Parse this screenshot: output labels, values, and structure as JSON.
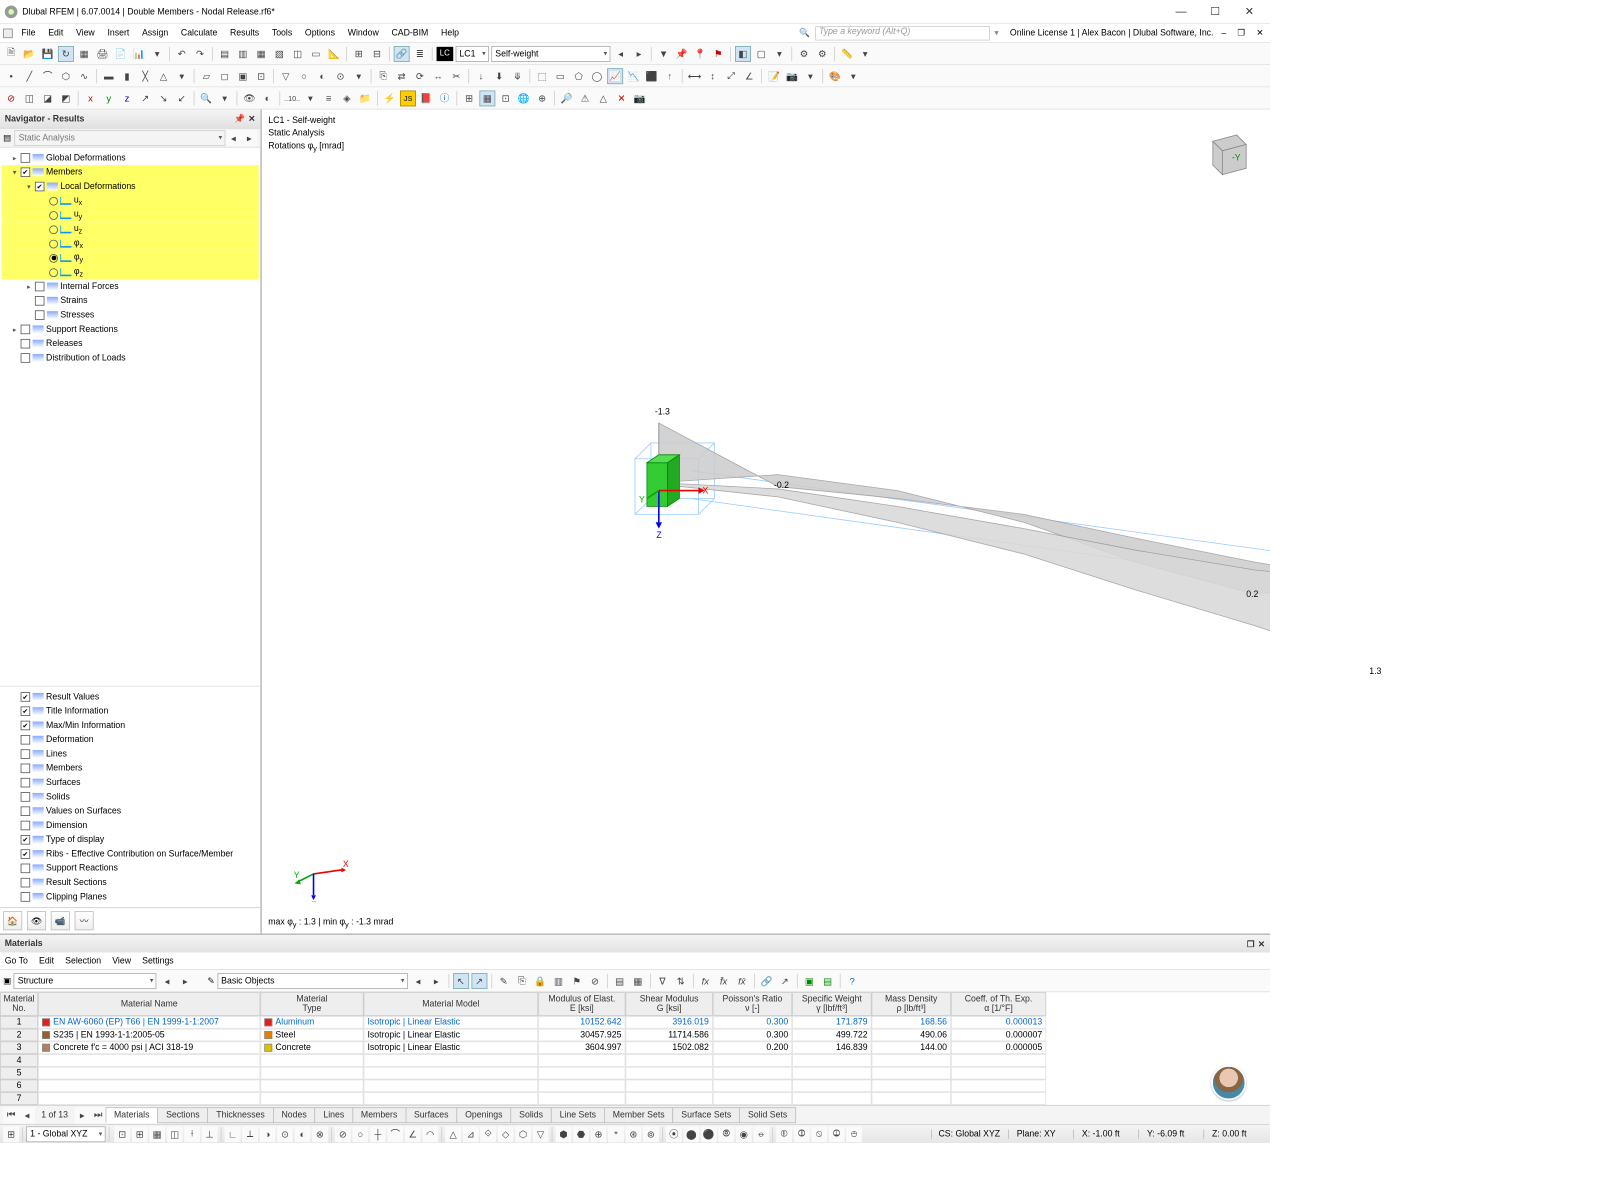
{
  "window": {
    "title": "Dlubal RFEM | 6.07.0014 | Double Members - Nodal Release.rf6*"
  },
  "menu": [
    "File",
    "Edit",
    "View",
    "Insert",
    "Assign",
    "Calculate",
    "Results",
    "Tools",
    "Options",
    "Window",
    "CAD-BIM",
    "Help"
  ],
  "kw_placeholder": "Type a keyword (Alt+Q)",
  "online_status": "Online License 1 | Alex Bacon | Dlubal Software, Inc.",
  "lc_chip": "LC",
  "lc_num": "LC1",
  "lc_name": "Self-weight",
  "navigator": {
    "title": "Navigator - Results",
    "combo": "Static Analysis"
  },
  "tree_top": [
    {
      "lbl": "Global Deformations",
      "ck": false,
      "ind": 0,
      "ar": "▸"
    },
    {
      "lbl": "Members",
      "ck": true,
      "ind": 0,
      "ar": "▾",
      "hl": true
    },
    {
      "lbl": "Local Deformations",
      "ck": true,
      "ind": 1,
      "ar": "▾",
      "hl": true
    },
    {
      "lbl": "u_x",
      "rd": false,
      "ind": 2,
      "hl": true,
      "sub": "x"
    },
    {
      "lbl": "u_y",
      "rd": false,
      "ind": 2,
      "hl": true,
      "sub": "y"
    },
    {
      "lbl": "u_z",
      "rd": false,
      "ind": 2,
      "hl": true,
      "sub": "z"
    },
    {
      "lbl": "φ_x",
      "rd": false,
      "ind": 2,
      "hl": true,
      "sub": "x",
      "ph": true
    },
    {
      "lbl": "φ_y",
      "rd": true,
      "ind": 2,
      "hl": true,
      "sub": "y",
      "ph": true
    },
    {
      "lbl": "φ_z",
      "rd": false,
      "ind": 2,
      "hl": true,
      "sub": "z",
      "ph": true
    },
    {
      "lbl": "Internal Forces",
      "ck": false,
      "ind": 1,
      "ar": "▸"
    },
    {
      "lbl": "Strains",
      "ck": false,
      "ind": 1
    },
    {
      "lbl": "Stresses",
      "ck": false,
      "ind": 1
    },
    {
      "lbl": "Support Reactions",
      "ck": false,
      "ind": 0,
      "ar": "▸"
    },
    {
      "lbl": "Releases",
      "ck": false,
      "ind": 0
    },
    {
      "lbl": "Distribution of Loads",
      "ck": false,
      "ind": 0
    }
  ],
  "tree_bot": [
    {
      "lbl": "Result Values",
      "ck": true
    },
    {
      "lbl": "Title Information",
      "ck": true
    },
    {
      "lbl": "Max/Min Information",
      "ck": true
    },
    {
      "lbl": "Deformation",
      "ck": false
    },
    {
      "lbl": "Lines",
      "ck": false
    },
    {
      "lbl": "Members",
      "ck": false
    },
    {
      "lbl": "Surfaces",
      "ck": false
    },
    {
      "lbl": "Solids",
      "ck": false
    },
    {
      "lbl": "Values on Surfaces",
      "ck": false
    },
    {
      "lbl": "Dimension",
      "ck": false
    },
    {
      "lbl": "Type of display",
      "ck": true
    },
    {
      "lbl": "Ribs - Effective Contribution on Surface/Member",
      "ck": true
    },
    {
      "lbl": "Support Reactions",
      "ck": false
    },
    {
      "lbl": "Result Sections",
      "ck": false
    },
    {
      "lbl": "Clipping Planes",
      "ck": false
    }
  ],
  "vp": {
    "l1": "LC1 - Self-weight",
    "l2": "Static Analysis",
    "l3a": "Rotations φ",
    "l3b": " [mrad]",
    "l3sub": "y",
    "minmax": "max φ_y : 1.3 | min φ_y : -1.3 mrad",
    "a1": "-1.3",
    "a2": "-0.2",
    "a3": "0.2",
    "a4": "1.3"
  },
  "materials": {
    "title": "Materials",
    "menu": [
      "Go To",
      "Edit",
      "Selection",
      "View",
      "Settings"
    ],
    "combo1": "Structure",
    "combo2": "Basic Objects",
    "head1": [
      "Material\nNo.",
      "Material Name",
      "Material\nType",
      "Material Model",
      "Modulus of Elast.\nE [ksi]",
      "Shear Modulus\nG [ksi]",
      "Poisson's Ratio\nν [-]",
      "Specific Weight\nγ [lbf/ft³]",
      "Mass Density\nρ [lb/ft³]",
      "Coeff. of Th. Exp.\nα [1/°F]"
    ],
    "rows": [
      {
        "n": "1",
        "name": "EN AW-6060 (EP) T66 | EN 1999-1-1:2007",
        "swc": "#e02020",
        "type": "Aluminum",
        "model": "Isotropic | Linear Elastic",
        "e": "10152.642",
        "g": "3916.019",
        "v": "0.300",
        "sw": "171.879",
        "md": "168.56",
        "a": "0.000013",
        "sel": true
      },
      {
        "n": "2",
        "name": "S235 | EN 1993-1-1:2005-05",
        "swc": "#906030",
        "type": "Steel",
        "model": "Isotropic | Linear Elastic",
        "e": "30457.925",
        "g": "11714.586",
        "v": "0.300",
        "sw": "499.722",
        "md": "490.06",
        "a": "0.000007"
      },
      {
        "n": "3",
        "name": "Concrete f'c = 4000 psi | ACI 318-19",
        "swc": "#b08060",
        "type": "Concrete",
        "model": "Isotropic | Linear Elastic",
        "e": "3604.997",
        "g": "1502.082",
        "v": "0.200",
        "sw": "146.839",
        "md": "144.00",
        "a": "0.000005"
      },
      {
        "n": "4"
      },
      {
        "n": "5"
      },
      {
        "n": "6"
      },
      {
        "n": "7"
      }
    ],
    "page": "1 of 13",
    "tabs": [
      "Materials",
      "Sections",
      "Thicknesses",
      "Nodes",
      "Lines",
      "Members",
      "Surfaces",
      "Openings",
      "Solids",
      "Line Sets",
      "Member Sets",
      "Surface Sets",
      "Solid Sets"
    ]
  },
  "status": {
    "cs_combo": "1 - Global XYZ",
    "cs": "CS: Global XYZ",
    "plane": "Plane: XY",
    "x": "X: -1.00 ft",
    "y": "Y: -6.09 ft",
    "z": "Z: 0.00 ft"
  }
}
